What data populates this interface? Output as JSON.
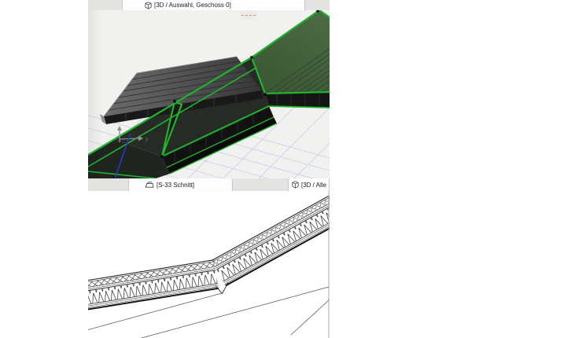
{
  "theme": {
    "selection-green": "#1fb32e",
    "grid-blue": "#c2cdec",
    "axis-blue": "#2838c8",
    "dash-orange": "#e28a50",
    "bar-gray": "#e3e3e1",
    "vp3d-bg": "#f1f1ef",
    "tab-bg": "#fdfdfd"
  },
  "tab_bars": {
    "top": {
      "tabs": [
        {
          "label": "[3D / Auswahl, Geschoss 0]",
          "icon": "cube-3d-icon"
        }
      ]
    },
    "bottom": {
      "tabs": [
        {
          "label": "[S-33 Schnitt]",
          "icon": "section-marker-icon"
        },
        {
          "label": "[3D / Alle",
          "icon": "cube-3d-icon"
        }
      ]
    }
  },
  "viewport_3d": {
    "axis_label": "y"
  },
  "palette": {
    "dash_count": 4
  }
}
